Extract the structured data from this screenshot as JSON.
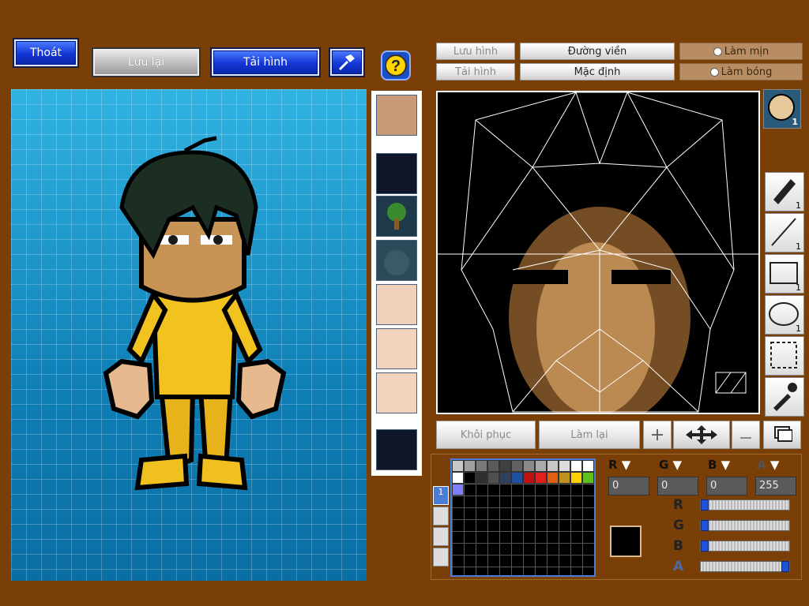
{
  "top_buttons": {
    "exit": "Thoát",
    "save": "Lưu lại",
    "load": "Tải hình"
  },
  "editor_buttons": {
    "save_image": "Lưu hình",
    "load_image": "Tải hình",
    "outline": "Đường viền",
    "default": "Mặc định",
    "smooth": "Làm mịn",
    "shine": "Làm bóng"
  },
  "action_buttons": {
    "restore": "Khôi phục",
    "redo": "Làm lại"
  },
  "rgba": {
    "r": "0",
    "g": "0",
    "b": "0",
    "a": "255"
  },
  "rgba_labels": {
    "r": "R",
    "g": "G",
    "b": "B",
    "a": "A"
  },
  "tool_counts": {
    "brush": "1",
    "line": "1",
    "rect": "1",
    "ellipse": "1",
    "head": "1"
  },
  "colors": {
    "background": "#7a3f06",
    "accent_blue": "#1336d6",
    "selected_color": "#000000"
  },
  "palette": [
    "#c8c8c8",
    "#a0a0a0",
    "#7a7a7a",
    "#5a5a5a",
    "#404040",
    "#606060",
    "#8a8a8a",
    "#aaaaaa",
    "#c8c8c8",
    "#dcdcdc",
    "#ffffff",
    "#ffffff",
    "#ffffff",
    "#000000",
    "#303030",
    "#505050",
    "#304060",
    "#2050a0",
    "#c01010",
    "#e02020",
    "#e06010",
    "#c09020",
    "#ffd000",
    "#60c020",
    "#8080ff"
  ]
}
